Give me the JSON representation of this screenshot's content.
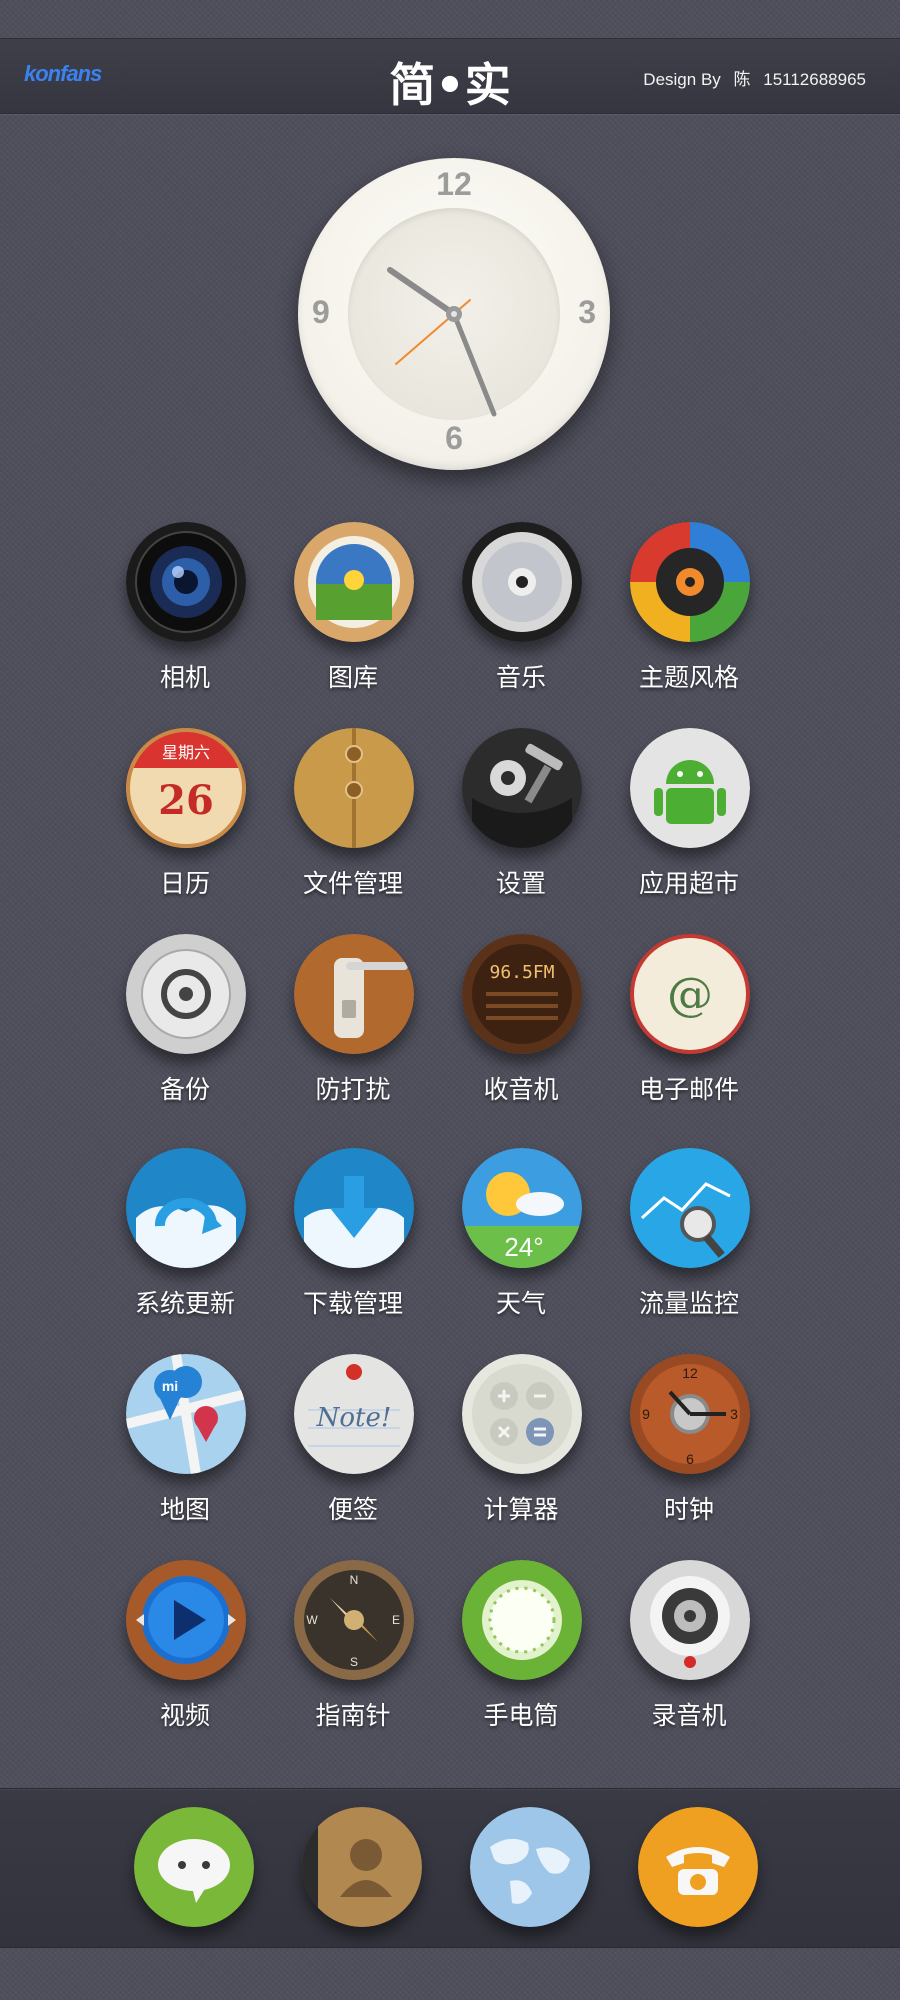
{
  "header": {
    "logo_text": "konfans",
    "title": "简•实",
    "credit_prefix": "Design By",
    "credit_name": "陈",
    "credit_phone": "15112688965"
  },
  "clock_widget": {
    "numerals": [
      "12",
      "3",
      "6",
      "9"
    ],
    "time": "10:25:40"
  },
  "apps": [
    {
      "label": "相机",
      "icon": "camera-lens-icon"
    },
    {
      "label": "图库",
      "icon": "gallery-photo-icon"
    },
    {
      "label": "音乐",
      "icon": "music-cd-icon"
    },
    {
      "label": "主题风格",
      "icon": "theme-palette-icon"
    },
    {
      "label": "日历",
      "icon": "calendar-icon",
      "icon_text": "星期六",
      "icon_number": "26"
    },
    {
      "label": "文件管理",
      "icon": "file-folder-icon"
    },
    {
      "label": "设置",
      "icon": "settings-gear-hammer-icon"
    },
    {
      "label": "应用超市",
      "icon": "android-market-icon"
    },
    {
      "label": "备份",
      "icon": "backup-dial-icon"
    },
    {
      "label": "防打扰",
      "icon": "do-not-disturb-door-icon"
    },
    {
      "label": "收音机",
      "icon": "radio-icon",
      "icon_text": "96.5FM"
    },
    {
      "label": "电子邮件",
      "icon": "email-envelope-icon",
      "icon_text": "@"
    },
    {
      "label": "系统更新",
      "icon": "system-update-icon"
    },
    {
      "label": "下载管理",
      "icon": "download-arrow-icon"
    },
    {
      "label": "天气",
      "icon": "weather-sun-icon",
      "icon_text": "24°"
    },
    {
      "label": "流量监控",
      "icon": "traffic-monitor-icon"
    },
    {
      "label": "地图",
      "icon": "map-pin-icon",
      "icon_text": "mi"
    },
    {
      "label": "便签",
      "icon": "note-paper-icon",
      "icon_text": "Note!"
    },
    {
      "label": "计算器",
      "icon": "calculator-icon"
    },
    {
      "label": "时钟",
      "icon": "clock-icon",
      "icon_numbers": [
        "12",
        "3",
        "6",
        "9"
      ]
    },
    {
      "label": "视频",
      "icon": "video-play-icon"
    },
    {
      "label": "指南针",
      "icon": "compass-icon",
      "icon_letters": [
        "N",
        "E",
        "S",
        "W"
      ]
    },
    {
      "label": "手电筒",
      "icon": "flashlight-icon"
    },
    {
      "label": "录音机",
      "icon": "recorder-icon"
    }
  ],
  "dock": [
    {
      "icon": "messages-bubble-icon"
    },
    {
      "icon": "contacts-person-icon"
    },
    {
      "icon": "browser-globe-icon"
    },
    {
      "icon": "phone-handset-icon"
    }
  ],
  "colors": {
    "background": "#4f4f5c",
    "header_bar": "#3a3a45",
    "label_text": "#ffffff",
    "clock_face": "#f6f4ee",
    "clock_second_hand": "#f08a2c"
  }
}
